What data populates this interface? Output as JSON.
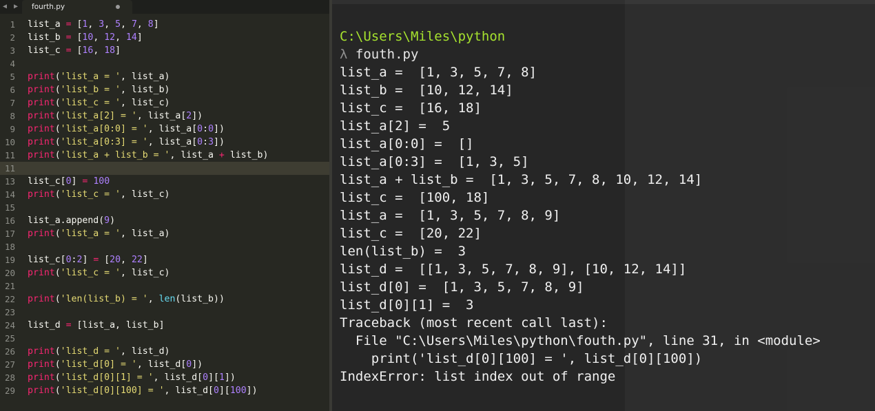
{
  "editor": {
    "nav_arrows": "◀ ▶",
    "tab": {
      "filename": "fourth.py"
    },
    "highlighted_line": 11,
    "lines": [
      {
        "n": "1",
        "tokens": [
          {
            "t": "list_a "
          },
          {
            "t": "=",
            "c": "op"
          },
          {
            "t": " ["
          },
          {
            "t": "1",
            "c": "nm"
          },
          {
            "t": ", "
          },
          {
            "t": "3",
            "c": "nm"
          },
          {
            "t": ", "
          },
          {
            "t": "5",
            "c": "nm"
          },
          {
            "t": ", "
          },
          {
            "t": "7",
            "c": "nm"
          },
          {
            "t": ", "
          },
          {
            "t": "8",
            "c": "nm"
          },
          {
            "t": "]"
          }
        ]
      },
      {
        "n": "2",
        "tokens": [
          {
            "t": "list_b "
          },
          {
            "t": "=",
            "c": "op"
          },
          {
            "t": " ["
          },
          {
            "t": "10",
            "c": "nm"
          },
          {
            "t": ", "
          },
          {
            "t": "12",
            "c": "nm"
          },
          {
            "t": ", "
          },
          {
            "t": "14",
            "c": "nm"
          },
          {
            "t": "]"
          }
        ]
      },
      {
        "n": "3",
        "tokens": [
          {
            "t": "list_c "
          },
          {
            "t": "=",
            "c": "op"
          },
          {
            "t": " ["
          },
          {
            "t": "16",
            "c": "nm"
          },
          {
            "t": ", "
          },
          {
            "t": "18",
            "c": "nm"
          },
          {
            "t": "]"
          }
        ]
      },
      {
        "n": "4",
        "tokens": []
      },
      {
        "n": "5",
        "tokens": [
          {
            "t": "print",
            "c": "fn"
          },
          {
            "t": "("
          },
          {
            "t": "'list_a = '",
            "c": "st"
          },
          {
            "t": ", list_a)"
          }
        ]
      },
      {
        "n": "6",
        "tokens": [
          {
            "t": "print",
            "c": "fn"
          },
          {
            "t": "("
          },
          {
            "t": "'list_b = '",
            "c": "st"
          },
          {
            "t": ", list_b)"
          }
        ]
      },
      {
        "n": "7",
        "tokens": [
          {
            "t": "print",
            "c": "fn"
          },
          {
            "t": "("
          },
          {
            "t": "'list_c = '",
            "c": "st"
          },
          {
            "t": ", list_c)"
          }
        ]
      },
      {
        "n": "8",
        "tokens": [
          {
            "t": "print",
            "c": "fn"
          },
          {
            "t": "("
          },
          {
            "t": "'list_a[2] = '",
            "c": "st"
          },
          {
            "t": ", list_a["
          },
          {
            "t": "2",
            "c": "nm"
          },
          {
            "t": "])"
          }
        ]
      },
      {
        "n": "9",
        "tokens": [
          {
            "t": "print",
            "c": "fn"
          },
          {
            "t": "("
          },
          {
            "t": "'list_a[0:0] = '",
            "c": "st"
          },
          {
            "t": ", list_a["
          },
          {
            "t": "0",
            "c": "nm"
          },
          {
            "t": ":"
          },
          {
            "t": "0",
            "c": "nm"
          },
          {
            "t": "])"
          }
        ]
      },
      {
        "n": "10",
        "tokens": [
          {
            "t": "print",
            "c": "fn"
          },
          {
            "t": "("
          },
          {
            "t": "'list_a[0:3] = '",
            "c": "st"
          },
          {
            "t": ", list_a["
          },
          {
            "t": "0",
            "c": "nm"
          },
          {
            "t": ":"
          },
          {
            "t": "3",
            "c": "nm"
          },
          {
            "t": "])"
          }
        ]
      },
      {
        "n": "11",
        "tokens": [
          {
            "t": "print",
            "c": "fn"
          },
          {
            "t": "("
          },
          {
            "t": "'list_a + list_b = '",
            "c": "st"
          },
          {
            "t": ", list_a "
          },
          {
            "t": "+",
            "c": "op"
          },
          {
            "t": " list_b)"
          }
        ]
      },
      {
        "n": "11",
        "tokens": []
      },
      {
        "n": "13",
        "tokens": [
          {
            "t": "list_c["
          },
          {
            "t": "0",
            "c": "nm"
          },
          {
            "t": "] "
          },
          {
            "t": "=",
            "c": "op"
          },
          {
            "t": " "
          },
          {
            "t": "100",
            "c": "nm"
          }
        ]
      },
      {
        "n": "14",
        "tokens": [
          {
            "t": "print",
            "c": "fn"
          },
          {
            "t": "("
          },
          {
            "t": "'list_c = '",
            "c": "st"
          },
          {
            "t": ", list_c)"
          }
        ]
      },
      {
        "n": "15",
        "tokens": []
      },
      {
        "n": "16",
        "tokens": [
          {
            "t": "list_a.append("
          },
          {
            "t": "9",
            "c": "nm"
          },
          {
            "t": ")"
          }
        ]
      },
      {
        "n": "17",
        "tokens": [
          {
            "t": "print",
            "c": "fn"
          },
          {
            "t": "("
          },
          {
            "t": "'list_a = '",
            "c": "st"
          },
          {
            "t": ", list_a)"
          }
        ]
      },
      {
        "n": "18",
        "tokens": []
      },
      {
        "n": "19",
        "tokens": [
          {
            "t": "list_c["
          },
          {
            "t": "0",
            "c": "nm"
          },
          {
            "t": ":"
          },
          {
            "t": "2",
            "c": "nm"
          },
          {
            "t": "] "
          },
          {
            "t": "=",
            "c": "op"
          },
          {
            "t": " ["
          },
          {
            "t": "20",
            "c": "nm"
          },
          {
            "t": ", "
          },
          {
            "t": "22",
            "c": "nm"
          },
          {
            "t": "]"
          }
        ]
      },
      {
        "n": "20",
        "tokens": [
          {
            "t": "print",
            "c": "fn"
          },
          {
            "t": "("
          },
          {
            "t": "'list_c = '",
            "c": "st"
          },
          {
            "t": ", list_c)"
          }
        ]
      },
      {
        "n": "21",
        "tokens": []
      },
      {
        "n": "22",
        "tokens": [
          {
            "t": "print",
            "c": "fn"
          },
          {
            "t": "("
          },
          {
            "t": "'len(list_b) = '",
            "c": "st"
          },
          {
            "t": ", "
          },
          {
            "t": "len",
            "c": "bi"
          },
          {
            "t": "(list_b))"
          }
        ]
      },
      {
        "n": "23",
        "tokens": []
      },
      {
        "n": "24",
        "tokens": [
          {
            "t": "list_d "
          },
          {
            "t": "=",
            "c": "op"
          },
          {
            "t": " [list_a, list_b]"
          }
        ]
      },
      {
        "n": "25",
        "tokens": []
      },
      {
        "n": "26",
        "tokens": [
          {
            "t": "print",
            "c": "fn"
          },
          {
            "t": "("
          },
          {
            "t": "'list_d = '",
            "c": "st"
          },
          {
            "t": ", list_d)"
          }
        ]
      },
      {
        "n": "27",
        "tokens": [
          {
            "t": "print",
            "c": "fn"
          },
          {
            "t": "("
          },
          {
            "t": "'list_d[0] = '",
            "c": "st"
          },
          {
            "t": ", list_d["
          },
          {
            "t": "0",
            "c": "nm"
          },
          {
            "t": "])"
          }
        ]
      },
      {
        "n": "28",
        "tokens": [
          {
            "t": "print",
            "c": "fn"
          },
          {
            "t": "("
          },
          {
            "t": "'list_d[0][1] = '",
            "c": "st"
          },
          {
            "t": ", list_d["
          },
          {
            "t": "0",
            "c": "nm"
          },
          {
            "t": "]["
          },
          {
            "t": "1",
            "c": "nm"
          },
          {
            "t": "])"
          }
        ]
      },
      {
        "n": "29",
        "tokens": [
          {
            "t": "print",
            "c": "fn"
          },
          {
            "t": "("
          },
          {
            "t": "'list_d[0][100] = '",
            "c": "st"
          },
          {
            "t": ", list_d["
          },
          {
            "t": "0",
            "c": "nm"
          },
          {
            "t": "]["
          },
          {
            "t": "100",
            "c": "nm"
          },
          {
            "t": "])"
          }
        ]
      }
    ]
  },
  "console": {
    "prompt_path": "C:\\Users\\Miles\\python",
    "prompt_symbol": "λ",
    "command": "fouth.py",
    "output": [
      "list_a =  [1, 3, 5, 7, 8]",
      "list_b =  [10, 12, 14]",
      "list_c =  [16, 18]",
      "list_a[2] =  5",
      "list_a[0:0] =  []",
      "list_a[0:3] =  [1, 3, 5]",
      "list_a + list_b =  [1, 3, 5, 7, 8, 10, 12, 14]",
      "list_c =  [100, 18]",
      "list_a =  [1, 3, 5, 7, 8, 9]",
      "list_c =  [20, 22]",
      "len(list_b) =  3",
      "list_d =  [[1, 3, 5, 7, 8, 9], [10, 12, 14]]",
      "list_d[0] =  [1, 3, 5, 7, 8, 9]",
      "list_d[0][1] =  3",
      "Traceback (most recent call last):",
      "  File \"C:\\Users\\Miles\\python\\fouth.py\", line 31, in <module>",
      "    print('list_d[0][100] = ', list_d[0][100])",
      "IndexError: list index out of range"
    ]
  },
  "colors": {
    "editor_bg": "#272822",
    "console_bg": "#262626",
    "keyword": "#f92672",
    "string": "#e6db74",
    "number": "#ae81ff",
    "builtin": "#66d9ef",
    "prompt_path": "#a6e22e"
  }
}
